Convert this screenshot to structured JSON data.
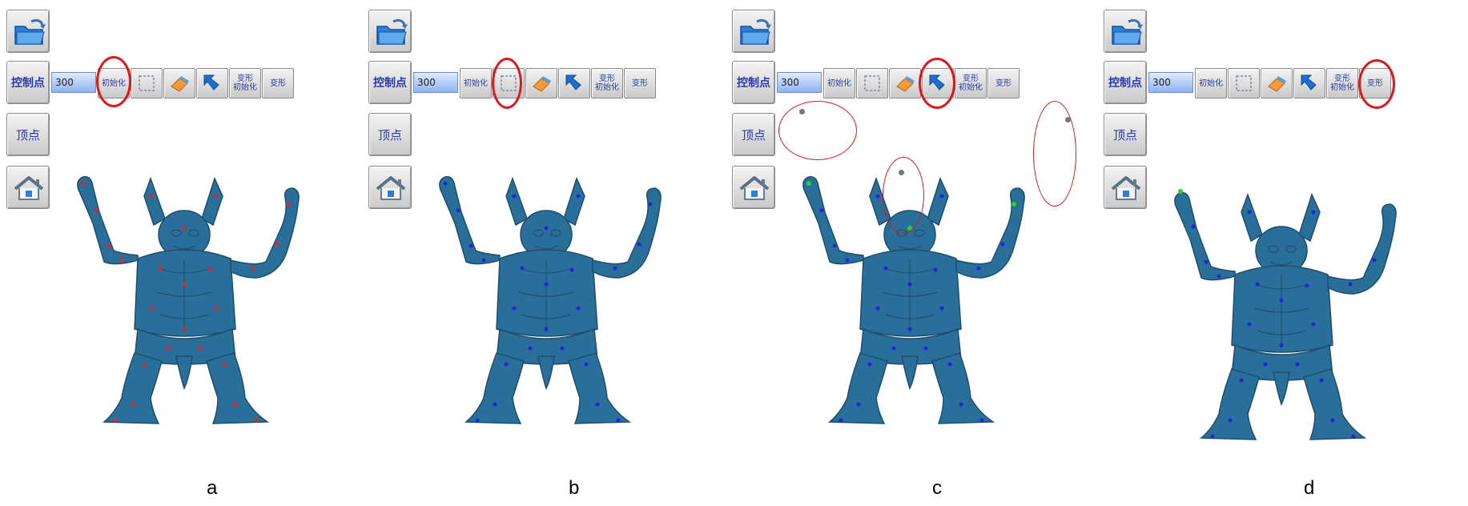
{
  "toolbar": {
    "control_points_label": "控制点",
    "control_points_value": "300",
    "init_label": "初始化",
    "deform_init_label_top": "变形",
    "deform_init_label_bottom": "初始化",
    "deform_label": "变形",
    "vertex_label": "顶点",
    "icons": [
      "open-folder-icon",
      "select-rectangle-icon",
      "eraser-icon",
      "arrow-cursor-icon",
      "home-icon"
    ]
  },
  "panels": [
    {
      "caption": "a",
      "highlight": "init-button",
      "point_color": "#e8232a"
    },
    {
      "caption": "b",
      "highlight": "select-rectangle-button",
      "point_color": "#1f24e0"
    },
    {
      "caption": "c",
      "highlight": "arrow-cursor-button",
      "point_color": "#1f24e0"
    },
    {
      "caption": "d",
      "highlight": "deform-button",
      "point_color": "#1f24e0"
    }
  ],
  "colors": {
    "model": "#2a6f99",
    "highlight": "#e0161c",
    "accent_green": "#28d12a"
  }
}
